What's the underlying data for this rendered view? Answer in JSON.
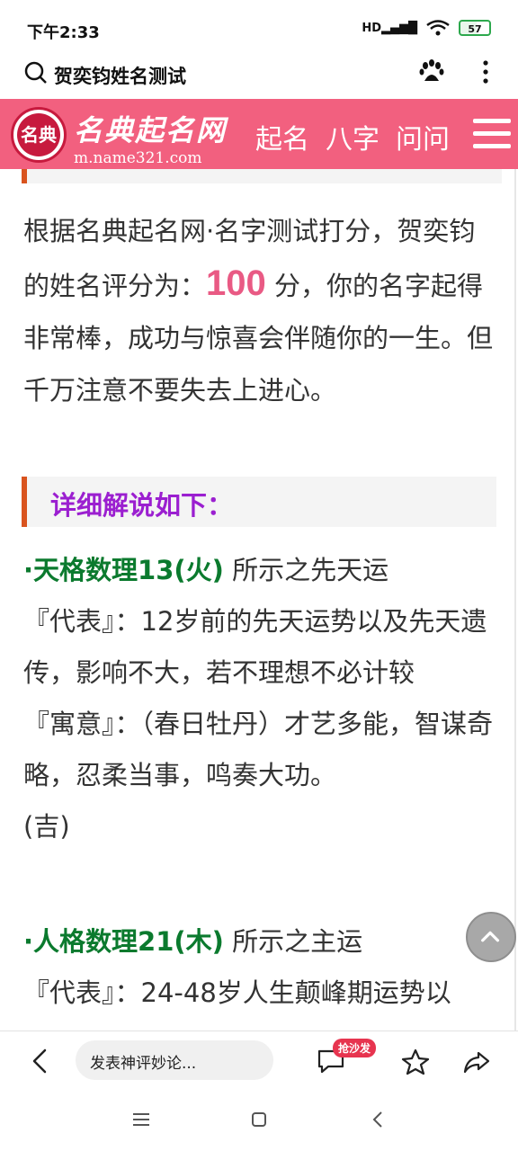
{
  "status_bar": {
    "time": "下午2:33",
    "signal_label": "HD",
    "battery": "57"
  },
  "search_bar": {
    "query": "贺奕钧姓名测试"
  },
  "site_header": {
    "logo_text": "名典",
    "brand_name": "名典起名网",
    "brand_url": "m.name321.com",
    "nav": [
      "起名",
      "八字",
      "问问"
    ]
  },
  "content": {
    "score_intro": "根据名典起名网·名字测试打分，贺奕钧的姓名评分为：",
    "score": "100",
    "score_outro": " 分，你的名字起得非常棒，成功与惊喜会伴随你的一生。但千万注意不要失去上进心。",
    "section_title": "详细解说如下：",
    "tiange": {
      "title": "·天格数理13(火)",
      "subtitle": "所示之先天运",
      "represent_label": "『代表』：",
      "represent": "12岁前的先天运势以及先天遗传，影响不大，若不理想不必计较",
      "meaning_label": "『寓意』：",
      "meaning": "（春日牡丹）才艺多能，智谋奇略，忍柔当事，鸣奏大功。",
      "luck": "(吉)"
    },
    "renge": {
      "title": "·人格数理21(木)",
      "subtitle": "所示之主运",
      "represent_label": "『代表』：",
      "represent": "24-48岁人生颠峰期运势以"
    }
  },
  "bottom_bar": {
    "comment_placeholder": "发表神评妙论...",
    "sofa_badge": "抢沙发"
  },
  "colors": {
    "header_bg": "#f2607f",
    "score_color": "#e95a84",
    "section_title_color": "#9b1fd0",
    "tag_color": "#0b7a2e"
  }
}
